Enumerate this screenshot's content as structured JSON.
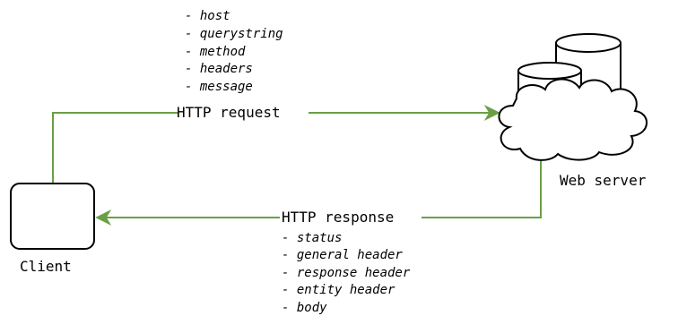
{
  "nodes": {
    "client": {
      "label": "Client"
    },
    "web_server": {
      "label": "Web server"
    }
  },
  "edges": {
    "request": {
      "label": "HTTP request",
      "items": [
        "host",
        "querystring",
        "method",
        "headers",
        "message"
      ]
    },
    "response": {
      "label": "HTTP response",
      "items": [
        "status",
        "general header",
        "response header",
        "entity header",
        "body"
      ]
    }
  },
  "colors": {
    "edge": "#6a9f45",
    "outline": "#000000",
    "fill": "#ffffff"
  }
}
